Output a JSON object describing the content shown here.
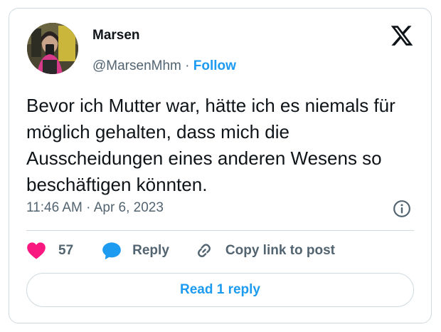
{
  "tweet": {
    "author_name": "Marsen",
    "author_handle": "@MarsenMhm",
    "separator": " · ",
    "follow_label": "Follow",
    "text": "Bevor ich Mutter war, hätte ich es niemals für möglich gehalten, dass mich die Ausscheidungen eines anderen Wesens so beschäftigen könnten.",
    "timestamp": "11:46 AM · Apr 6, 2023"
  },
  "actions": {
    "likes_count": "57",
    "reply_label": "Reply",
    "copy_link_label": "Copy link to post"
  },
  "footer": {
    "read_replies_label": "Read 1 reply"
  },
  "icons": {
    "brand": "x-logo-icon",
    "info": "info-icon",
    "like": "heart-icon",
    "reply": "speech-bubble-icon",
    "copy": "link-icon"
  },
  "colors": {
    "accent": "#1d9bf0",
    "like": "#f91880",
    "muted_text": "#536471",
    "border": "#cfd9de"
  }
}
